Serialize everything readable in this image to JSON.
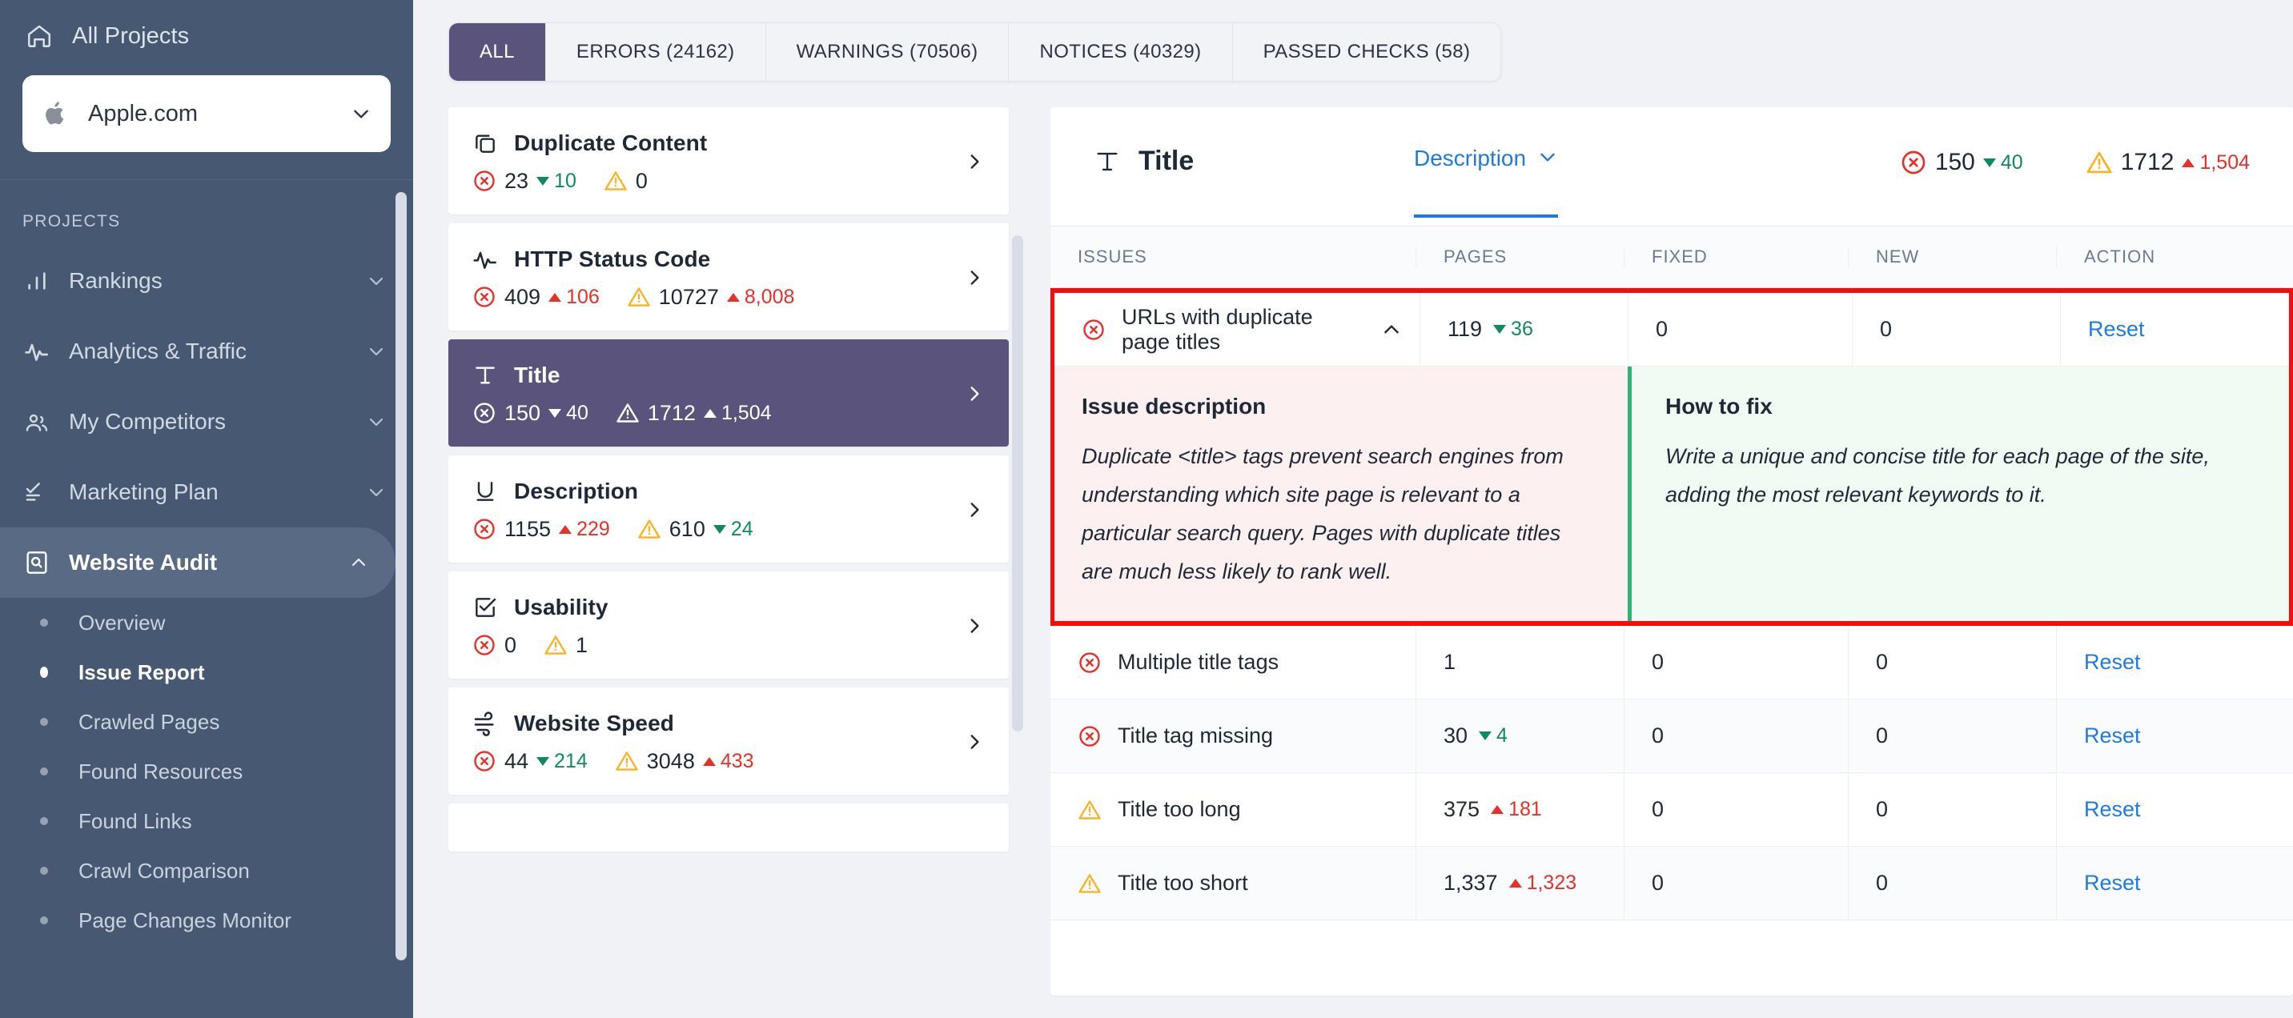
{
  "sidebar": {
    "all_projects": "All Projects",
    "project": {
      "name": "Apple.com",
      "icon": "apple-icon"
    },
    "section_label": "PROJECTS",
    "items": [
      {
        "label": "Rankings",
        "icon": "bar-chart-icon",
        "expanded": false
      },
      {
        "label": "Analytics & Traffic",
        "icon": "pulse-icon",
        "expanded": false
      },
      {
        "label": "My Competitors",
        "icon": "people-icon",
        "expanded": false
      },
      {
        "label": "Marketing Plan",
        "icon": "checklist-icon",
        "expanded": false
      },
      {
        "label": "Website Audit",
        "icon": "magnifier-doc-icon",
        "expanded": true
      }
    ],
    "sub_items": [
      {
        "label": "Overview",
        "active": false
      },
      {
        "label": "Issue Report",
        "active": true
      },
      {
        "label": "Crawled Pages",
        "active": false
      },
      {
        "label": "Found Resources",
        "active": false
      },
      {
        "label": "Found Links",
        "active": false
      },
      {
        "label": "Crawl Comparison",
        "active": false
      },
      {
        "label": "Page Changes Monitor",
        "active": false
      }
    ]
  },
  "tabs": [
    {
      "label": "ALL",
      "active": true
    },
    {
      "label": "ERRORS (24162)",
      "active": false
    },
    {
      "label": "WARNINGS (70506)",
      "active": false
    },
    {
      "label": "NOTICES (40329)",
      "active": false
    },
    {
      "label": "PASSED CHECKS (58)",
      "active": false
    }
  ],
  "categories": [
    {
      "title": "Duplicate Content",
      "icon": "copy-icon",
      "selected": false,
      "errors": "23",
      "errors_delta": "10",
      "errors_dir": "down",
      "warnings": "0",
      "warnings_delta": "",
      "warnings_dir": ""
    },
    {
      "title": "HTTP Status Code",
      "icon": "pulse-icon",
      "selected": false,
      "errors": "409",
      "errors_delta": "106",
      "errors_dir": "up",
      "warnings": "10727",
      "warnings_delta": "8,008",
      "warnings_dir": "up"
    },
    {
      "title": "Title",
      "icon": "title-t-icon",
      "selected": true,
      "errors": "150",
      "errors_delta": "40",
      "errors_dir": "down",
      "warnings": "1712",
      "warnings_delta": "1,504",
      "warnings_dir": "up"
    },
    {
      "title": "Description",
      "icon": "underline-u-icon",
      "selected": false,
      "errors": "1155",
      "errors_delta": "229",
      "errors_dir": "up",
      "warnings": "610",
      "warnings_delta": "24",
      "warnings_dir": "down"
    },
    {
      "title": "Usability",
      "icon": "checkbox-icon",
      "selected": false,
      "errors": "0",
      "errors_delta": "",
      "errors_dir": "",
      "warnings": "1",
      "warnings_delta": "",
      "warnings_dir": ""
    },
    {
      "title": "Website Speed",
      "icon": "wind-icon",
      "selected": false,
      "errors": "44",
      "errors_delta": "214",
      "errors_dir": "down",
      "warnings": "3048",
      "warnings_delta": "433",
      "warnings_dir": "up"
    }
  ],
  "panel": {
    "title": "Title",
    "title_icon": "title-t-icon",
    "dropdown_label": "Description",
    "errors": "150",
    "errors_delta": "40",
    "errors_dir": "down",
    "warnings": "1712",
    "warnings_delta": "1,504",
    "warnings_dir": "up",
    "columns": {
      "issues": "ISSUES",
      "pages": "PAGES",
      "fixed": "FIXED",
      "new": "NEW",
      "action": "ACTION"
    },
    "rows": [
      {
        "severity": "error",
        "name": "URLs with duplicate page titles",
        "pages": "119",
        "pages_delta": "36",
        "pages_dir": "down",
        "fixed": "0",
        "new": "0",
        "action": "Reset",
        "expanded": true,
        "highlighted": true,
        "issue_description_heading": "Issue description",
        "issue_description": "Duplicate <title> tags prevent search engines from understanding which site page is relevant to a particular search query. Pages with duplicate titles are much less likely to rank well.",
        "how_to_fix_heading": "How to fix",
        "how_to_fix": "Write a unique and concise title for each page of the site, adding the most relevant keywords to it."
      },
      {
        "severity": "error",
        "name": "Multiple title tags",
        "pages": "1",
        "pages_delta": "",
        "pages_dir": "",
        "fixed": "0",
        "new": "0",
        "action": "Reset",
        "expanded": false,
        "highlighted": false
      },
      {
        "severity": "error",
        "name": "Title tag missing",
        "pages": "30",
        "pages_delta": "4",
        "pages_dir": "down",
        "fixed": "0",
        "new": "0",
        "action": "Reset",
        "expanded": false,
        "highlighted": false
      },
      {
        "severity": "warning",
        "name": "Title too long",
        "pages": "375",
        "pages_delta": "181",
        "pages_dir": "up",
        "fixed": "0",
        "new": "0",
        "action": "Reset",
        "expanded": false,
        "highlighted": false
      },
      {
        "severity": "warning",
        "name": "Title too short",
        "pages": "1,337",
        "pages_delta": "1,323",
        "pages_dir": "up",
        "fixed": "0",
        "new": "0",
        "action": "Reset",
        "expanded": false,
        "highlighted": false
      }
    ]
  },
  "colors": {
    "sidebar_bg": "#465872",
    "accent_purple": "#5a547c",
    "link_blue": "#1f7ae0",
    "error_red": "#e8302a",
    "warning_yellow": "#f6b426",
    "success_green": "#0f8a5f",
    "highlight_border": "#f40d0d"
  }
}
